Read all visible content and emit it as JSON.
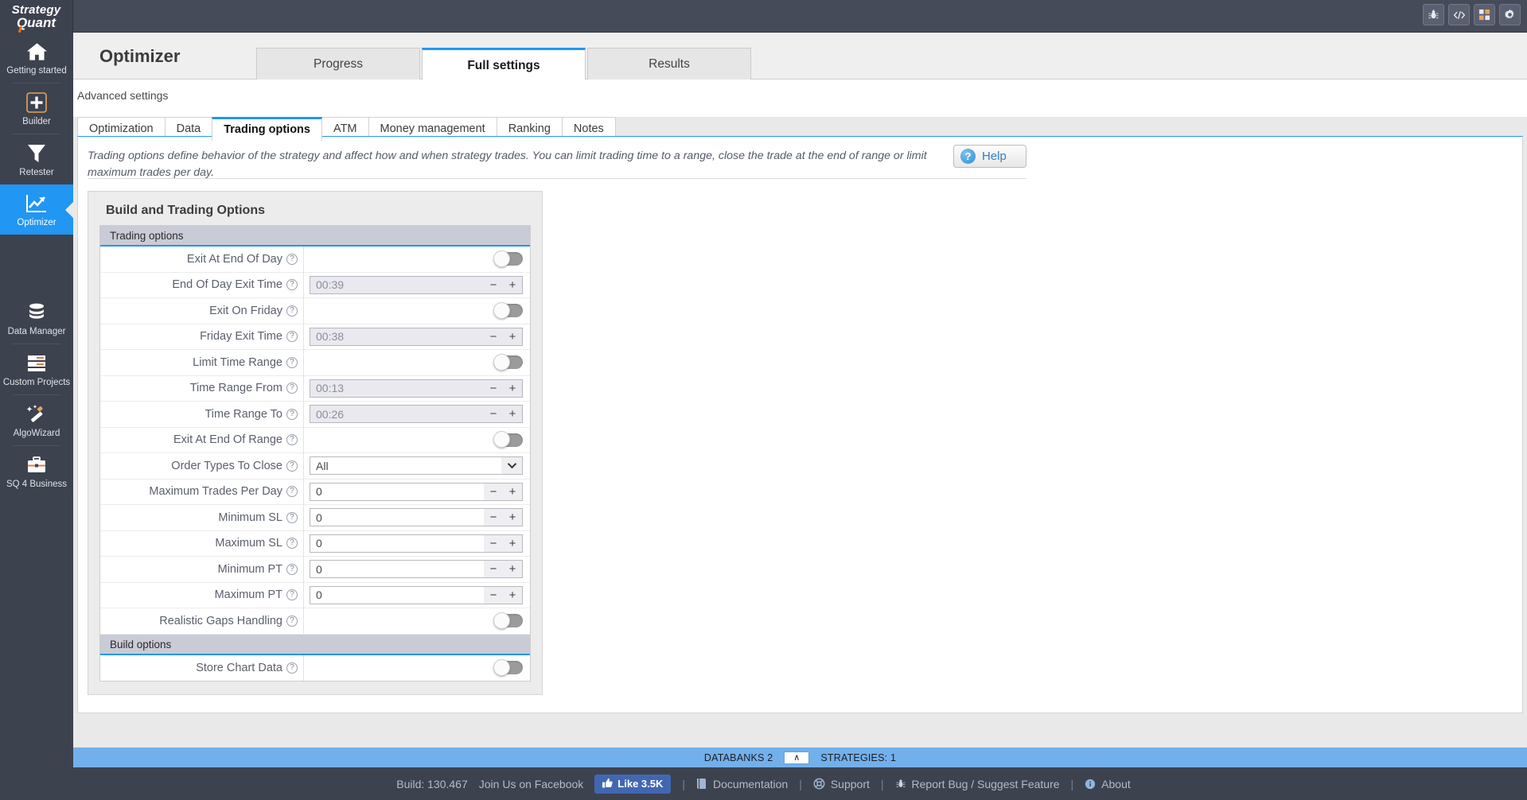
{
  "app": {
    "logo_line1": "Strategy",
    "logo_line2": "Quant"
  },
  "topbar": {
    "icons": [
      {
        "name": "bug-icon",
        "glyph": "bug"
      },
      {
        "name": "code-icon",
        "glyph": "code"
      },
      {
        "name": "grid-icon",
        "glyph": "grid"
      },
      {
        "name": "gear-icon",
        "glyph": "gear"
      }
    ]
  },
  "sidebar": {
    "items": [
      {
        "label": "Getting started",
        "icon": "home-icon",
        "active": false
      },
      {
        "label": "Builder",
        "icon": "plus-icon",
        "active": false
      },
      {
        "label": "Retester",
        "icon": "funnel-icon",
        "active": false
      },
      {
        "label": "Optimizer",
        "icon": "chart-line-icon",
        "active": true
      },
      {
        "label": "Data Manager",
        "icon": "database-icon",
        "active": false
      },
      {
        "label": "Custom Projects",
        "icon": "server-icon",
        "active": false
      },
      {
        "label": "AlgoWizard",
        "icon": "magic-wand-icon",
        "active": false
      },
      {
        "label": "SQ 4 Business",
        "icon": "briefcase-icon",
        "active": false
      }
    ]
  },
  "header": {
    "title": "Optimizer",
    "tabs": [
      {
        "label": "Progress",
        "active": false
      },
      {
        "label": "Full settings",
        "active": true
      },
      {
        "label": "Results",
        "active": false
      }
    ]
  },
  "subheader": {
    "advanced_label": "Advanced settings",
    "tabs": [
      {
        "label": "Optimization",
        "active": false
      },
      {
        "label": "Data",
        "active": false
      },
      {
        "label": "Trading options",
        "active": true
      },
      {
        "label": "ATM",
        "active": false
      },
      {
        "label": "Money management",
        "active": false
      },
      {
        "label": "Ranking",
        "active": false
      },
      {
        "label": "Notes",
        "active": false
      }
    ]
  },
  "panel": {
    "description": "Trading options define behavior of the strategy and affect how and when strategy trades. You can limit trading time to a range, close the trade at the end of range or limit maximum trades per day.",
    "help_label": "Help",
    "card_title": "Build and Trading Options",
    "groups": [
      {
        "title": "Trading options",
        "rows": [
          {
            "label": "Exit At End Of Day",
            "type": "toggle",
            "value": "off",
            "disabled": false
          },
          {
            "label": "End Of Day Exit Time",
            "type": "spinner",
            "value": "00:39",
            "disabled": true
          },
          {
            "label": "Exit On Friday",
            "type": "toggle",
            "value": "off",
            "disabled": false
          },
          {
            "label": "Friday Exit Time",
            "type": "spinner",
            "value": "00:38",
            "disabled": true
          },
          {
            "label": "Limit Time Range",
            "type": "toggle",
            "value": "off",
            "disabled": false
          },
          {
            "label": "Time Range From",
            "type": "spinner",
            "value": "00:13",
            "disabled": true
          },
          {
            "label": "Time Range To",
            "type": "spinner",
            "value": "00:26",
            "disabled": true
          },
          {
            "label": "Exit At End Of Range",
            "type": "toggle",
            "value": "off",
            "disabled": false
          },
          {
            "label": "Order Types To Close",
            "type": "select",
            "value": "All",
            "disabled": false
          },
          {
            "label": "Maximum Trades Per Day",
            "type": "spinner",
            "value": "0",
            "disabled": false
          },
          {
            "label": "Minimum SL",
            "type": "spinner",
            "value": "0",
            "disabled": false
          },
          {
            "label": "Maximum SL",
            "type": "spinner",
            "value": "0",
            "disabled": false
          },
          {
            "label": "Minimum PT",
            "type": "spinner",
            "value": "0",
            "disabled": false
          },
          {
            "label": "Maximum PT",
            "type": "spinner",
            "value": "0",
            "disabled": false
          },
          {
            "label": "Realistic Gaps Handling",
            "type": "toggle",
            "value": "off",
            "disabled": false
          }
        ]
      },
      {
        "title": "Build options",
        "rows": [
          {
            "label": "Store Chart Data",
            "type": "toggle",
            "value": "off",
            "disabled": false
          }
        ]
      }
    ],
    "stepper_minus": "−",
    "stepper_plus": "+",
    "help_icon_glyph": "?",
    "question_glyph": "?"
  },
  "statusbar": {
    "databanks_label": "DATABANKS 2",
    "collapse_glyph": "∧",
    "strategies_label": "STRATEGIES: 1"
  },
  "footer": {
    "build": "Build: 130.467",
    "facebook": "Join Us on Facebook",
    "like": "Like 3.5K",
    "items": [
      {
        "label": "Documentation",
        "icon": "book-icon"
      },
      {
        "label": "Support",
        "icon": "lifebuoy-icon"
      },
      {
        "label": "Report Bug / Suggest Feature",
        "icon": "bug-icon"
      },
      {
        "label": "About",
        "icon": "info-icon"
      }
    ],
    "separator": "|"
  },
  "colors": {
    "accent": "#2196f3",
    "sidebar_bg": "#3d424f",
    "topbar_bg": "#464b5a",
    "statusbar_bg": "#72b0ec",
    "group_header_bg": "#c9cbd6"
  }
}
